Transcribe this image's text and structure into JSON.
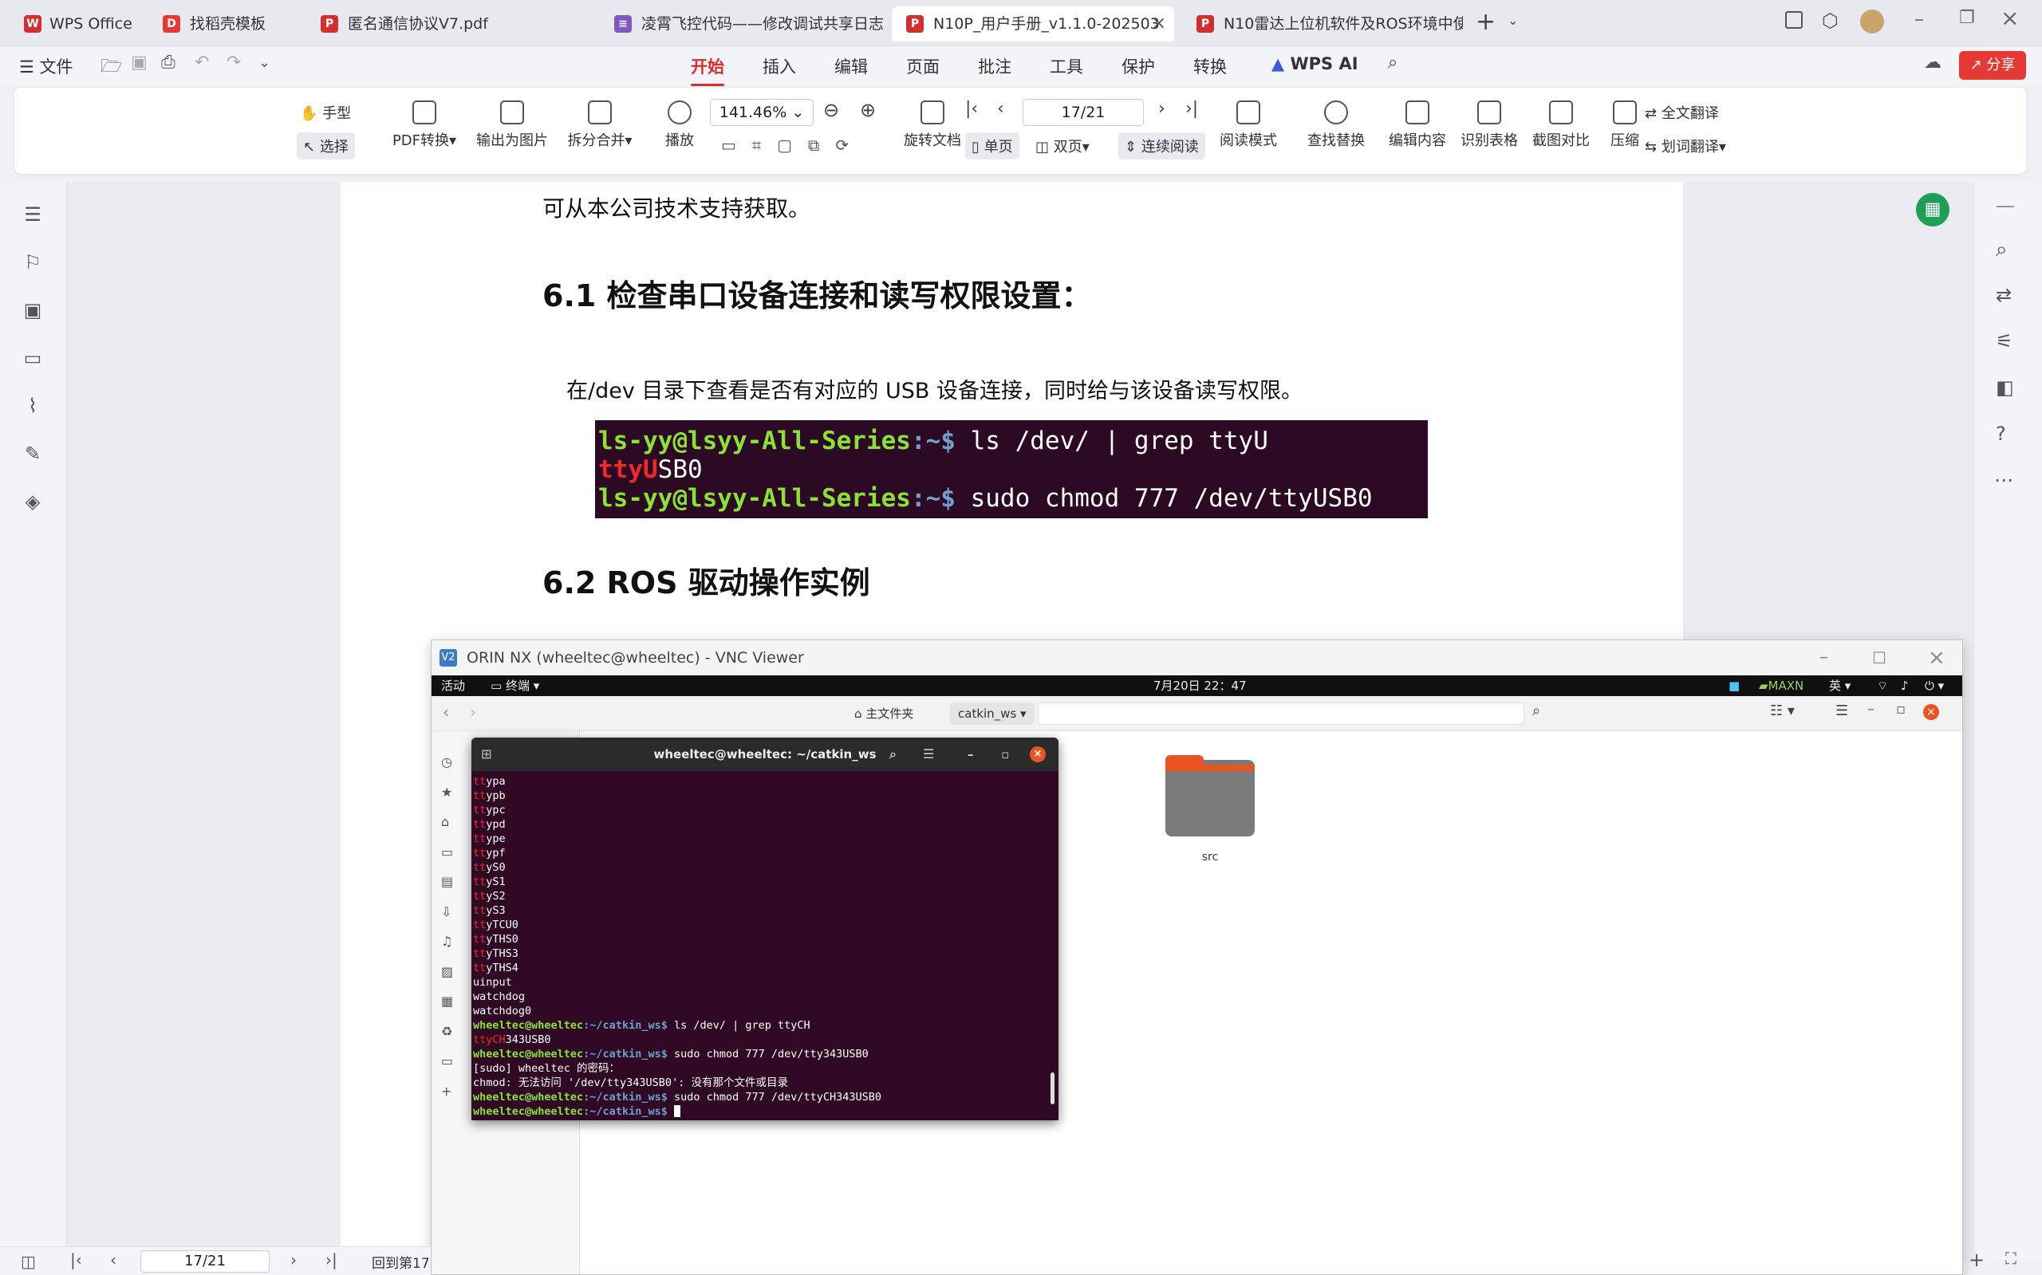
{
  "tabs": [
    {
      "label": "WPS Office",
      "icon_color": "#d32f2f",
      "icon": "W"
    },
    {
      "label": "找稻壳模板",
      "icon_color": "#e53935",
      "icon": "D"
    },
    {
      "label": "匿名通信协议V7.pdf",
      "icon_color": "#d32f2f",
      "icon": "P"
    },
    {
      "label": "凌霄飞控代码——修改调试共享日志",
      "icon_color": "#7e57c2",
      "icon": "≡"
    },
    {
      "label": "N10P_用户手册_v1.1.0-202503",
      "icon_color": "#d32f2f",
      "icon": "P"
    },
    {
      "label": "N10雷达上位机软件及ROS环境中使",
      "icon_color": "#d32f2f",
      "icon": "P"
    }
  ],
  "menu": {
    "file": "文件",
    "items": [
      "开始",
      "插入",
      "编辑",
      "页面",
      "批注",
      "工具",
      "保护",
      "转换"
    ],
    "wps_ai": "WPS AI",
    "share": "分享"
  },
  "ribbon": {
    "hand": "手型",
    "select": "选择",
    "pdf_convert": "PDF转换",
    "export_image": "输出为图片",
    "split_merge": "拆分合并",
    "play": "播放",
    "zoom": "141.46%",
    "page": "17/21",
    "rotate": "旋转文档",
    "single": "单页",
    "double": "双页",
    "continuous": "连续阅读",
    "reading_mode": "阅读模式",
    "find_replace": "查找替换",
    "edit_content": "编辑内容",
    "recognize_table": "识别表格",
    "screenshot_compare": "截图对比",
    "compress": "压缩",
    "translate_all": "全文翻译",
    "word_translate": "划词翻译"
  },
  "doc": {
    "line1": "可从本公司技术支持获取。",
    "h61": "6.1  检查串口设备连接和读写权限设置：",
    "p1": "在/dev 目录下查看是否有对应的 USB 设备连接，同时给与该设备读写权限。",
    "term": {
      "user": "ls-yy@lsyy-All-Series",
      "path": ":~$",
      "cmd1": " ls /dev/ | grep ttyU",
      "out_red": "ttyU",
      "out_rest": "SB0",
      "cmd2": " sudo chmod 777 /dev/ttyUSB0"
    },
    "h62": "6.2 ROS 驱动操作实例"
  },
  "vnc": {
    "title": "ORIN NX (wheeltec@wheeltec) - VNC Viewer",
    "activities": "活动",
    "terminal_app": "终端",
    "datetime": "7月20日 22：47",
    "maxn": "MAXN",
    "lang": "英",
    "home": "主文件夹",
    "folder": "catkin_ws",
    "src": "src",
    "term_title": "wheeltec@wheeltec: ~/catkin_ws",
    "tty_lines": [
      "ypa",
      "ypb",
      "ypc",
      "ypd",
      "ype",
      "ypf",
      "yS0",
      "yS1",
      "yS2",
      "yS3",
      "yTCU0",
      "yTHS0",
      "yTHS3",
      "yTHS4"
    ],
    "uinput": "uinput",
    "wd1": "watchdog",
    "wd2": "watchdog0",
    "prompt_user": "wheeltec@wheeltec",
    "prompt_path": ":~/catkin_ws$",
    "c1": " ls /dev/ | grep ttyCH",
    "o1_red": "ttyCH",
    "o1_rest": "343USB0",
    "c2": " sudo chmod 777 /dev/tty343USB0",
    "sudo": "[sudo] wheeltec 的密码：",
    "err": "chmod: 无法访问 '/dev/tty343USB0': 没有那个文件或目录",
    "c3": " sudo chmod 777 /dev/ttyCH343USB0"
  },
  "status": {
    "page": "17/21",
    "back": "回到第17"
  }
}
